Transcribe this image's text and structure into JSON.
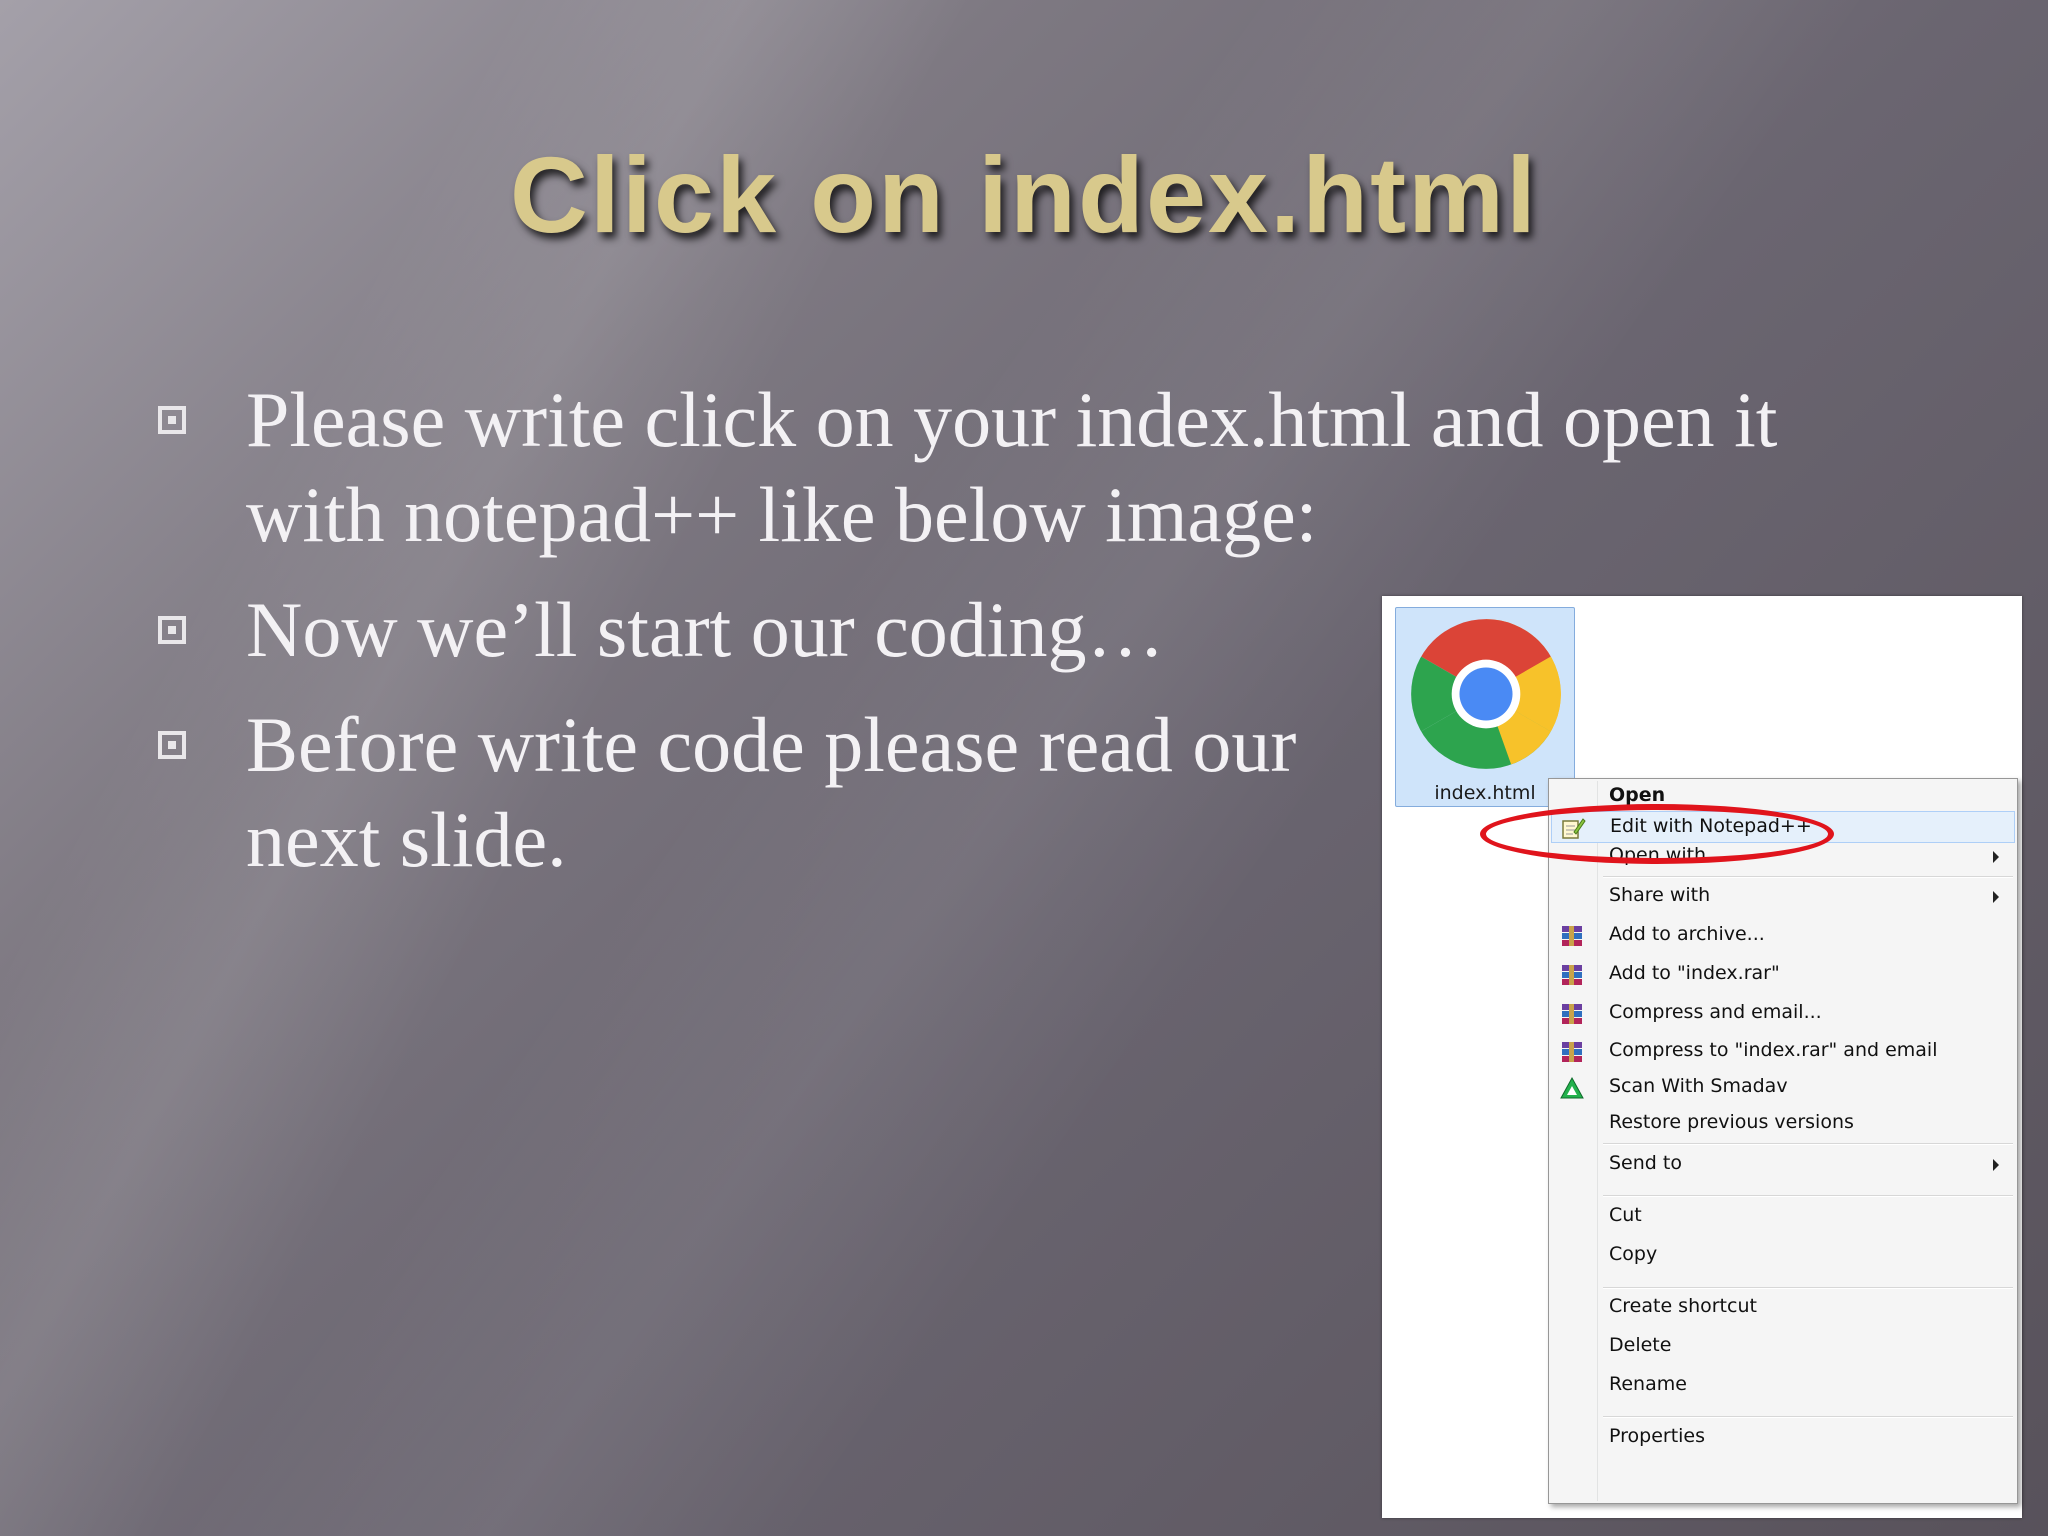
{
  "slide": {
    "title": "Click on index.html",
    "bullets": [
      "Please write click on your index.html and open it with notepad++ like below image:",
      "Now we’ll start our coding…",
      "Before write code please read our next slide."
    ]
  },
  "explorer": {
    "file_name": "index.html",
    "file_icon": "chrome-icon",
    "menu": {
      "open": "Open",
      "edit_notepad": "Edit with Notepad++",
      "open_with": "Open with",
      "share_with": "Share with",
      "add_archive": "Add to archive...",
      "add_rar": "Add to \"index.rar\"",
      "compress_email": "Compress and email...",
      "compress_rar_email": "Compress to \"index.rar\" and email",
      "scan_smadav": "Scan With Smadav",
      "restore_versions": "Restore previous versions",
      "send_to": "Send to",
      "cut": "Cut",
      "copy": "Copy",
      "create_shortcut": "Create shortcut",
      "delete": "Delete",
      "rename": "Rename",
      "properties": "Properties"
    },
    "highlight_color": "#e0141c"
  }
}
